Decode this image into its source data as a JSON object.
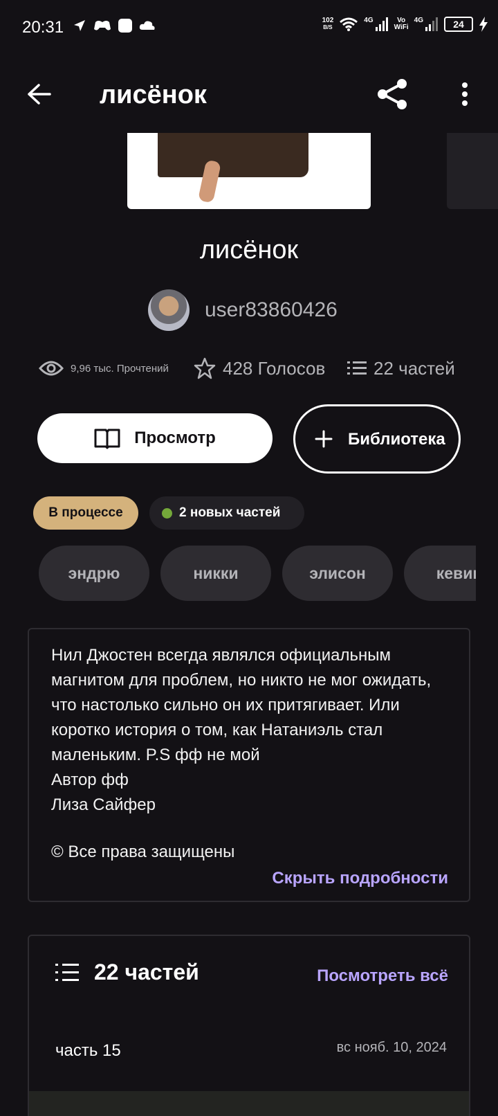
{
  "status_bar": {
    "time": "20:31",
    "speed_value": "102",
    "speed_unit": "B/S",
    "net1": "4G",
    "volte_top": "Vo",
    "volte_bottom": "WiFi",
    "net2": "4G",
    "battery": "24"
  },
  "app_bar": {
    "title": "лисёнок"
  },
  "story": {
    "title": "лисёнок",
    "author": "user83860426",
    "reads": "9,96 тыс. Прочтений",
    "votes": "428 Голосов",
    "parts": "22 частей"
  },
  "actions": {
    "view_label": "Просмотр",
    "library_label": "Библиотека"
  },
  "badges": {
    "status": "В процессе",
    "new_parts": "2 новых частей"
  },
  "tags": [
    "эндрю",
    "никки",
    "элисон",
    "кевин"
  ],
  "description": {
    "text": "Нил Джостен всегда являлся официальным магнитом для проблем, но никто не мог ожидать, что настолько сильно он их притягивает. Или коротко история о том, как Натаниэль стал маленьким. P.S фф не мой\nАвтор фф\nЛиза Сайфер",
    "copyright": "© Все права защищены",
    "toggle": "Скрыть подробности"
  },
  "parts_section": {
    "title": "22 частей",
    "view_all": "Посмотреть всё",
    "items": [
      {
        "name": "часть 15",
        "date": "вс нояб. 10, 2024"
      }
    ]
  },
  "colors": {
    "background": "#131115",
    "accent": "#b9a5ff",
    "status_badge": "#d4b27c",
    "new_dot": "#74a83a"
  }
}
